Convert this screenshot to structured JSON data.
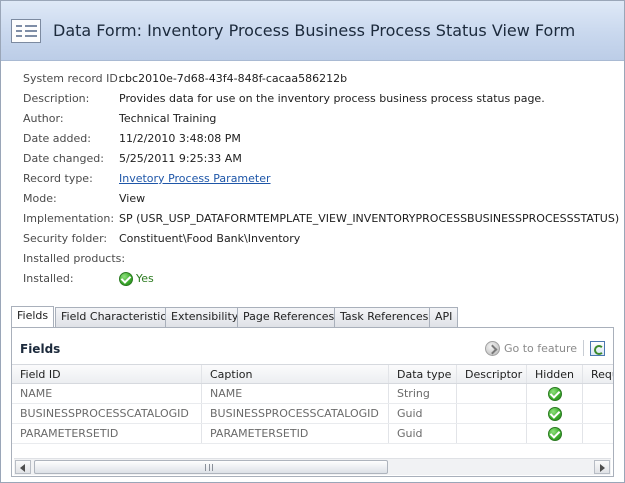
{
  "header": {
    "title": "Data Form:  Inventory Process Business Process Status View Form",
    "icon": "form-icon"
  },
  "properties": [
    {
      "label": "System record ID:",
      "value": "cbc2010e-7d68-43f4-848f-cacaa586212b"
    },
    {
      "label": "Description:",
      "value": "Provides data for use on the inventory process business process status page."
    },
    {
      "label": "Author:",
      "value": "Technical Training"
    },
    {
      "label": "Date added:",
      "value": "11/2/2010 3:48:08 PM"
    },
    {
      "label": "Date changed:",
      "value": "5/25/2011 9:25:33 AM"
    },
    {
      "label": "Record type:",
      "value": "Invetory Process Parameter",
      "link": true
    },
    {
      "label": "Mode:",
      "value": "View"
    },
    {
      "label": "Implementation:",
      "value": "SP (USR_USP_DATAFORMTEMPLATE_VIEW_INVENTORYPROCESSBUSINESSPROCESSSTATUS)"
    },
    {
      "label": "Security folder:",
      "value": "Constituent\\Food Bank\\Inventory"
    },
    {
      "label": "Installed products:",
      "value": ""
    },
    {
      "label": "Installed:",
      "value": "Yes",
      "icon": "check-icon"
    }
  ],
  "tabs": [
    {
      "label": "Fields",
      "active": true
    },
    {
      "label": "Field Characteristics"
    },
    {
      "label": "Extensibility"
    },
    {
      "label": "Page References"
    },
    {
      "label": "Task References"
    },
    {
      "label": "API"
    }
  ],
  "panel": {
    "title": "Fields",
    "goto_label": "Go to feature",
    "columns": [
      "Field ID",
      "Caption",
      "Data type",
      "Descriptor",
      "Hidden",
      "Requ"
    ],
    "rows": [
      {
        "field_id": "NAME",
        "caption": "NAME",
        "data_type": "String",
        "descriptor": "",
        "hidden": true
      },
      {
        "field_id": "BUSINESSPROCESSCATALOGID",
        "caption": "BUSINESSPROCESSCATALOGID",
        "data_type": "Guid",
        "descriptor": "",
        "hidden": true
      },
      {
        "field_id": "PARAMETERSETID",
        "caption": "PARAMETERSETID",
        "data_type": "Guid",
        "descriptor": "",
        "hidden": true
      }
    ]
  },
  "colors": {
    "header_bg": "#c9d8ee",
    "link": "#1e56a8",
    "check_green": "#3fae2f"
  }
}
